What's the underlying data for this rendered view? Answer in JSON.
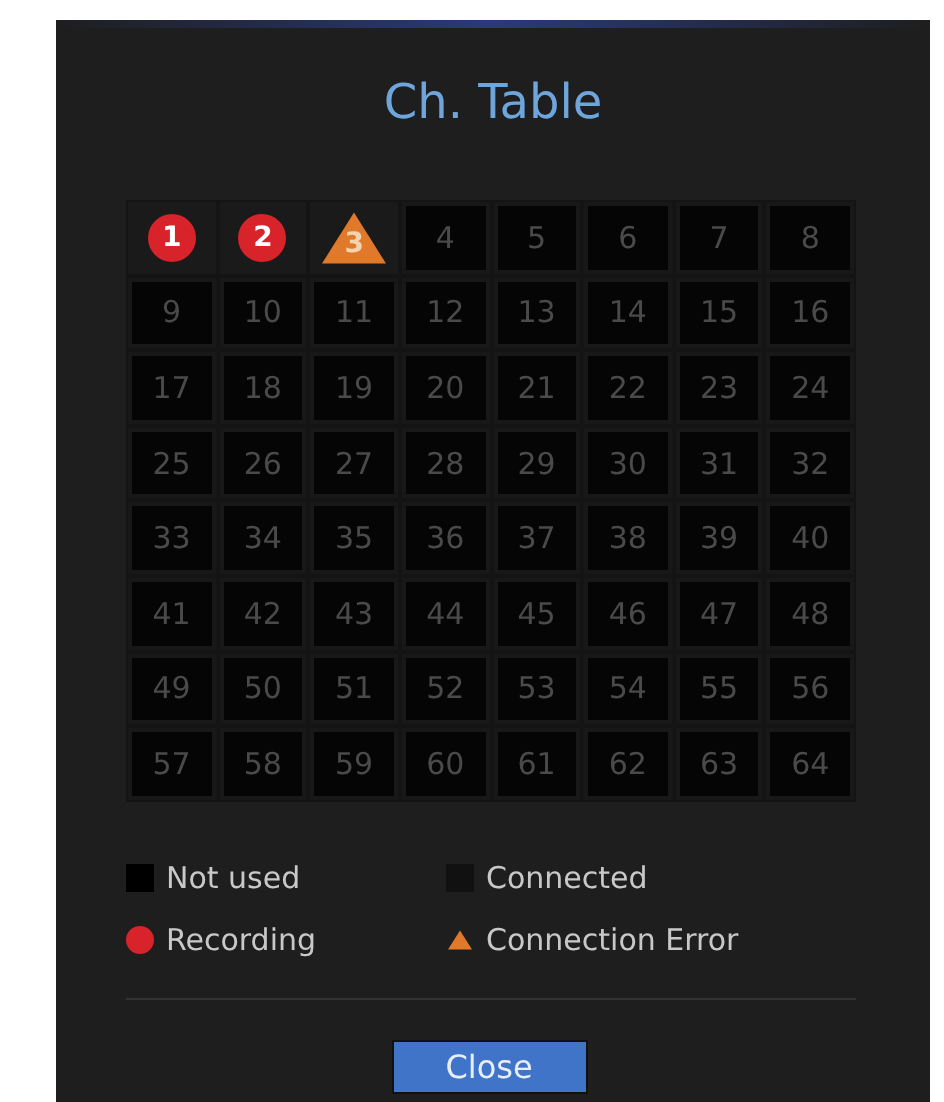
{
  "dialog": {
    "title": "Ch. Table"
  },
  "channels": [
    {
      "label": "1",
      "kind": "recording"
    },
    {
      "label": "2",
      "kind": "recording"
    },
    {
      "label": "3",
      "kind": "error"
    },
    {
      "label": "4",
      "kind": "not_used"
    },
    {
      "label": "5",
      "kind": "not_used"
    },
    {
      "label": "6",
      "kind": "not_used"
    },
    {
      "label": "7",
      "kind": "not_used"
    },
    {
      "label": "8",
      "kind": "not_used"
    },
    {
      "label": "9",
      "kind": "not_used"
    },
    {
      "label": "10",
      "kind": "not_used"
    },
    {
      "label": "11",
      "kind": "not_used"
    },
    {
      "label": "12",
      "kind": "not_used"
    },
    {
      "label": "13",
      "kind": "not_used"
    },
    {
      "label": "14",
      "kind": "not_used"
    },
    {
      "label": "15",
      "kind": "not_used"
    },
    {
      "label": "16",
      "kind": "not_used"
    },
    {
      "label": "17",
      "kind": "not_used"
    },
    {
      "label": "18",
      "kind": "not_used"
    },
    {
      "label": "19",
      "kind": "not_used"
    },
    {
      "label": "20",
      "kind": "not_used"
    },
    {
      "label": "21",
      "kind": "not_used"
    },
    {
      "label": "22",
      "kind": "not_used"
    },
    {
      "label": "23",
      "kind": "not_used"
    },
    {
      "label": "24",
      "kind": "not_used"
    },
    {
      "label": "25",
      "kind": "not_used"
    },
    {
      "label": "26",
      "kind": "not_used"
    },
    {
      "label": "27",
      "kind": "not_used"
    },
    {
      "label": "28",
      "kind": "not_used"
    },
    {
      "label": "29",
      "kind": "not_used"
    },
    {
      "label": "30",
      "kind": "not_used"
    },
    {
      "label": "31",
      "kind": "not_used"
    },
    {
      "label": "32",
      "kind": "not_used"
    },
    {
      "label": "33",
      "kind": "not_used"
    },
    {
      "label": "34",
      "kind": "not_used"
    },
    {
      "label": "35",
      "kind": "not_used"
    },
    {
      "label": "36",
      "kind": "not_used"
    },
    {
      "label": "37",
      "kind": "not_used"
    },
    {
      "label": "38",
      "kind": "not_used"
    },
    {
      "label": "39",
      "kind": "not_used"
    },
    {
      "label": "40",
      "kind": "not_used"
    },
    {
      "label": "41",
      "kind": "not_used"
    },
    {
      "label": "42",
      "kind": "not_used"
    },
    {
      "label": "43",
      "kind": "not_used"
    },
    {
      "label": "44",
      "kind": "not_used"
    },
    {
      "label": "45",
      "kind": "not_used"
    },
    {
      "label": "46",
      "kind": "not_used"
    },
    {
      "label": "47",
      "kind": "not_used"
    },
    {
      "label": "48",
      "kind": "not_used"
    },
    {
      "label": "49",
      "kind": "not_used"
    },
    {
      "label": "50",
      "kind": "not_used"
    },
    {
      "label": "51",
      "kind": "not_used"
    },
    {
      "label": "52",
      "kind": "not_used"
    },
    {
      "label": "53",
      "kind": "not_used"
    },
    {
      "label": "54",
      "kind": "not_used"
    },
    {
      "label": "55",
      "kind": "not_used"
    },
    {
      "label": "56",
      "kind": "not_used"
    },
    {
      "label": "57",
      "kind": "not_used"
    },
    {
      "label": "58",
      "kind": "not_used"
    },
    {
      "label": "59",
      "kind": "not_used"
    },
    {
      "label": "60",
      "kind": "not_used"
    },
    {
      "label": "61",
      "kind": "not_used"
    },
    {
      "label": "62",
      "kind": "not_used"
    },
    {
      "label": "63",
      "kind": "not_used"
    },
    {
      "label": "64",
      "kind": "not_used"
    }
  ],
  "legend": [
    {
      "label": "Not used",
      "kind": "not_used"
    },
    {
      "label": "Connected",
      "kind": "connected"
    },
    {
      "label": "Recording",
      "kind": "recording"
    },
    {
      "label": "Connection Error",
      "kind": "error"
    }
  ],
  "buttons": [
    "Close"
  ]
}
